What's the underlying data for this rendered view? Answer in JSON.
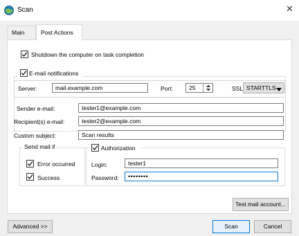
{
  "window": {
    "title": "Scan",
    "app_icon": "scanner-globe-icon",
    "close_icon": "close-icon"
  },
  "tabs": [
    {
      "label": "Main"
    },
    {
      "label": "Post Actions"
    }
  ],
  "shutdown": {
    "label": "Shutdown the computer on task completion",
    "checked": true
  },
  "email": {
    "label": "E-mail notifications",
    "checked": true,
    "server_label": "Server:",
    "server_value": "mail.example.com",
    "port_label": "Port:",
    "port_value": "25",
    "ssl_label": "SSL",
    "ssl_value": "STARTTLS",
    "sender_label": "Sender e-mail:",
    "sender_value": "tester1@example.com",
    "recipient_label": "Recipient(s) e-mail:",
    "recipient_value": "tester2@example.com",
    "subject_label": "Custom subject:",
    "subject_value": "Scan results"
  },
  "send_if": {
    "label": "Send mail if",
    "error_label": "Error occurred",
    "error_checked": true,
    "success_label": "Success",
    "success_checked": true
  },
  "auth": {
    "label": "Authorization",
    "checked": true,
    "login_label": "Login:",
    "login_value": "tester1",
    "password_label": "Password:",
    "password_value": "••••••••"
  },
  "buttons": {
    "test": "Test mail account...",
    "advanced": "Advanced >>",
    "scan": "Scan",
    "cancel": "Cancel"
  },
  "colors": {
    "accent": "#0078d7",
    "panel": "#ffffff",
    "window": "#f0f0f0"
  }
}
